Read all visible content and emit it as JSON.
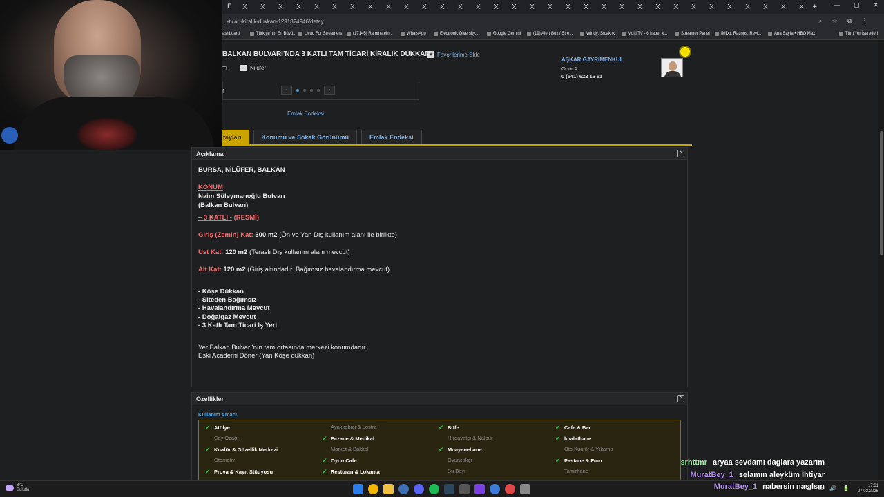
{
  "browser": {
    "tab_letter": "E",
    "tab_x": "X",
    "win_controls": [
      "—",
      "▢",
      "✕"
    ],
    "url": "...-ticari-kiralik-dukkan-1291824946/detay",
    "addr_icons": [
      "⌕",
      "☆",
      "⧉",
      "⋮"
    ],
    "bookmarks": [
      "ashboard",
      "Türkiye'nin En Büyü...",
      "Livad For Streamers",
      "(17145) Rammstein...",
      "WhatsApp",
      "Electronic Diversity...",
      "Google Gemini",
      "(19) Alert Box / Stre...",
      "Windy: Sıcaklık",
      "Multi TV - 6 haber k...",
      "Streamer Panel",
      "IMDb: Ratings, Revi...",
      "Ana Sayfa • HBO Max",
      "Tüm Yer İşaretleri"
    ]
  },
  "listing": {
    "title": "BALKAN BULVARI'NDA 3 KATLI TAM TİCARİ KİRALIK DÜKKAN",
    "favorite_label": "Favorilerime Ekle",
    "price_fragment": "TL",
    "district": "Nilüfer",
    "frag_f": "f",
    "emlak_endeksi_link": "Emlak Endeksi",
    "gallery_prev": "‹",
    "gallery_next": "›"
  },
  "agent": {
    "company": "AŞKAR GAYRİMENKUL",
    "person": "Onur A.",
    "phone": "0 (541) 622 16 61"
  },
  "tabs": [
    {
      "label": "tayları",
      "active": true
    },
    {
      "label": "Konumu ve Sokak Görünümü",
      "active": false
    },
    {
      "label": "Emlak Endeksi",
      "active": false
    }
  ],
  "description": {
    "header": "Açıklama",
    "collapse": "^",
    "location_line": "BURSA, NİLÜFER, BALKAN",
    "konum_label": "KONUM",
    "street_line1": "Naim Süleymanoğlu Bulvarı",
    "street_line2": "(Balkan Bulvarı)",
    "floors_label": "– 3 KATLI -",
    "floors_official": "(RESMİ)",
    "giris_label": "Giriş (Zemin) Kat:",
    "giris_area": "300 m2",
    "giris_note": "(Ön ve Yan Dış kullanım alanı ile birlikte)",
    "ust_label": "Üst Kat:",
    "ust_area": "120 m2",
    "ust_note": "(Teraslı Dış kullanım alanı mevcut)",
    "alt_label": "Alt Kat:",
    "alt_area": "120 m2",
    "alt_note": "(Giriş altındadır. Bağımsız havalandırma mevcut)",
    "bullets": [
      "- Köşe Dükkan",
      "- Siteden Bağımsız",
      "- Havalandırma Mevcut",
      "- Doğalgaz Mevcut",
      "- 3 Katlı Tam Ticari İş Yeri"
    ],
    "closing1": "Yer Balkan Bulvarı'nın tam ortasında merkezi konumdadır.",
    "closing2": "Eski Academi Döner (Yan Köşe dükkan)"
  },
  "features": {
    "header": "Özellikler",
    "collapse": "^",
    "subheader": "Kullanım Amacı",
    "check_glyph": "✔",
    "columns": [
      [
        {
          "label": "Atölye",
          "on": true
        },
        {
          "label": "Çay Ocağı",
          "on": false
        },
        {
          "label": "Kuaför & Güzellik Merkezi",
          "on": true
        },
        {
          "label": "Otomotiv",
          "on": false
        },
        {
          "label": "Prova & Kayıt Stüdyosu",
          "on": true
        }
      ],
      [
        {
          "label": "Ayakkabıcı & Lostra",
          "on": false
        },
        {
          "label": "Eczane & Medikal",
          "on": true
        },
        {
          "label": "Market & Bakkal",
          "on": false
        },
        {
          "label": "Oyun Cafe",
          "on": true
        },
        {
          "label": "Restoran & Lokanta",
          "on": true
        }
      ],
      [
        {
          "label": "Büfe",
          "on": true
        },
        {
          "label": "Hırdavatçı & Nalbur",
          "on": false
        },
        {
          "label": "Muayenehane",
          "on": true
        },
        {
          "label": "Oyuncakçı",
          "on": false
        },
        {
          "label": "Su Bayi",
          "on": false
        }
      ],
      [
        {
          "label": "Cafe & Bar",
          "on": true
        },
        {
          "label": "İmalathane",
          "on": true
        },
        {
          "label": "Oto Kuaför & Yıkama",
          "on": false
        },
        {
          "label": "Pastane & Fırın",
          "on": true
        },
        {
          "label": "Tamirhane",
          "on": false
        }
      ]
    ]
  },
  "chat": [
    {
      "user": "srhttmr",
      "message": "aryaa sevdamı daglara yazarım"
    },
    {
      "user": "MuratBey_1",
      "message": "selamın aleyküm İhtiyar"
    },
    {
      "user": "MuratBey_1",
      "message": "nabersin nasılsın"
    }
  ],
  "taskbar": {
    "temp": "8°C",
    "condition": "Bulutlu",
    "time": "17:31",
    "date": "27.02.2026",
    "tray": [
      "⌃",
      "☁",
      "▭",
      "🔊",
      "🔋"
    ]
  },
  "colors": {
    "accent_blue": "#7fb1e8",
    "accent_red": "#f26d6d",
    "tab_gold": "#c9a300",
    "check_green": "#2ecc40"
  }
}
